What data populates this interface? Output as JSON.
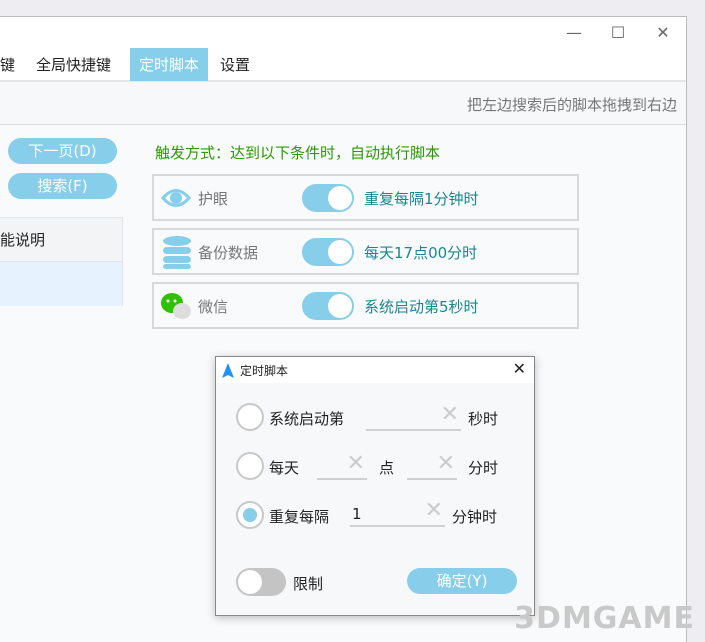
{
  "window": {
    "controls": {
      "minimize": "—",
      "maximize": "☐",
      "close": "✕"
    }
  },
  "menu": [
    "键",
    "全局快捷键",
    "定时脚本",
    "设置"
  ],
  "hint": "把左边搜索后的脚本拖拽到右边",
  "left": {
    "next_page": "下一页(D)",
    "search": "搜索(F)",
    "table_header": "能说明"
  },
  "trigger_title": "触发方式：达到以下条件时，自动执行脚本",
  "cards": [
    {
      "icon": "eye-icon",
      "label": "护眼",
      "enabled": true,
      "condition": "重复每隔1分钟时"
    },
    {
      "icon": "database-icon",
      "label": "备份数据",
      "enabled": true,
      "condition": "每天17点00分时"
    },
    {
      "icon": "wechat-icon",
      "label": "微信",
      "enabled": true,
      "condition": "系统启动第5秒时"
    }
  ],
  "dialog": {
    "title": "定时脚本",
    "close": "✕",
    "opt1": {
      "label": "系统启动第",
      "value": "",
      "unit": "秒时"
    },
    "opt2": {
      "label": "每天",
      "hour": "",
      "mid": "点",
      "minute": "",
      "unit": "分时"
    },
    "opt3": {
      "label": "重复每隔",
      "value": "1",
      "unit": "分钟时"
    },
    "selected": 3,
    "limit_label": "限制",
    "limit_on": false,
    "confirm": "确定(Y)",
    "clear": "✕"
  },
  "watermark": "3DMGAME",
  "colors": {
    "accent": "#87ceeb",
    "green": "#2a9a00",
    "teal": "#17888f"
  }
}
